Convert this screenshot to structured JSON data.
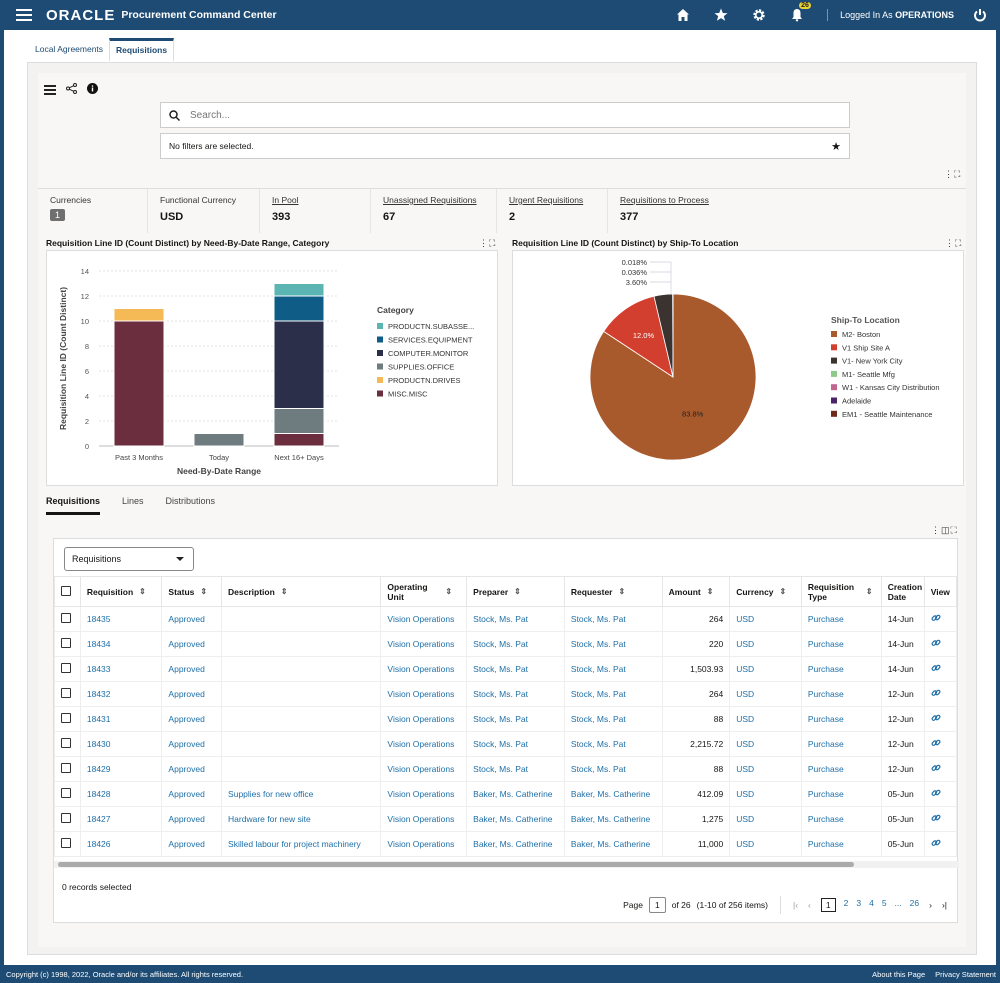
{
  "header": {
    "logo": "ORACLE",
    "app_title": "Procurement Command Center",
    "notification_count": "26",
    "logged_in_prefix": "Logged In As",
    "logged_in_user": "OPERATIONS",
    "icons": [
      "hamburger-icon",
      "home-icon",
      "star-icon",
      "gear-icon",
      "bell-icon",
      "power-icon"
    ]
  },
  "tabs": [
    {
      "label": "Local Agreements",
      "active": false
    },
    {
      "label": "Requisitions",
      "active": true
    }
  ],
  "search": {
    "placeholder": "Search...",
    "value": ""
  },
  "filters_text": "No filters are selected.",
  "kpis": [
    {
      "label": "Currencies",
      "value": "1",
      "badge": true,
      "link": false
    },
    {
      "label": "Functional Currency",
      "value": "USD",
      "link": false
    },
    {
      "label": "In Pool",
      "value": "393",
      "link": true
    },
    {
      "label": "Unassigned Requisitions",
      "value": "67",
      "link": true
    },
    {
      "label": "Urgent Requisitions",
      "value": "2",
      "link": true
    },
    {
      "label": "Requisitions to Process",
      "value": "377",
      "link": true
    }
  ],
  "chart_data": [
    {
      "type": "bar",
      "stacked": true,
      "title": "Requisition Line ID (Count Distinct) by Need-By-Date Range, Category",
      "xlabel": "Need-By-Date Range",
      "ylabel": "Requisition Line ID (Count Distinct)",
      "ylim": [
        0,
        14
      ],
      "yticks": [
        0,
        2,
        4,
        6,
        8,
        10,
        12,
        14
      ],
      "categories": [
        "Past 3 Months",
        "Today",
        "Next 16+ Days"
      ],
      "legend_title": "Category",
      "legend_position": "right",
      "series": [
        {
          "name": "MISC.MISC",
          "color": "#6b2e3e",
          "values": [
            10,
            0,
            1
          ]
        },
        {
          "name": "SUPPLIES.OFFICE",
          "color": "#6e7b7f",
          "values": [
            0,
            1,
            2
          ]
        },
        {
          "name": "COMPUTER.MONITOR",
          "color": "#2b2f4a",
          "values": [
            0,
            0,
            7
          ]
        },
        {
          "name": "SERVICES.EQUIPMENT",
          "color": "#0f5c86",
          "values": [
            0,
            0,
            2
          ]
        },
        {
          "name": "PRODUCTN.DRIVES",
          "color": "#f5b955",
          "values": [
            1,
            0,
            0
          ]
        },
        {
          "name": "PRODUCTN.SUBASSE...",
          "color": "#5bb5b3",
          "values": [
            0,
            0,
            1
          ]
        }
      ],
      "legend_order": [
        "PRODUCTN.SUBASSE...",
        "SERVICES.EQUIPMENT",
        "COMPUTER.MONITOR",
        "SUPPLIES.OFFICE",
        "PRODUCTN.DRIVES",
        "MISC.MISC"
      ]
    },
    {
      "type": "pie",
      "title": "Requisition Line ID (Count Distinct) by Ship-To Location",
      "legend_title": "Ship-To Location",
      "legend_position": "right",
      "slices": [
        {
          "name": "M2- Boston",
          "value": 83.8,
          "label": "83.8%",
          "color": "#a85a2d"
        },
        {
          "name": "V1 Ship Site A",
          "value": 12.0,
          "label": "12.0%",
          "color": "#d33f2e"
        },
        {
          "name": "V1- New York City",
          "value": 3.6,
          "label": "3.60%",
          "color": "#3a3330"
        },
        {
          "name": "M1- Seattle Mfg",
          "value": 0.036,
          "label": "0.036%",
          "color": "#8fc98a"
        },
        {
          "name": "W1 - Kansas City Distribution",
          "value": 0.018,
          "label": "0.018%",
          "color": "#c2668f"
        },
        {
          "name": "Adelaide",
          "value": 0,
          "label": "",
          "color": "#4a2466"
        },
        {
          "name": "EM1 - Seattle Maintenance",
          "value": 0,
          "label": "",
          "color": "#6e2b1a"
        }
      ]
    }
  ],
  "subtabs": [
    {
      "label": "Requisitions",
      "active": true
    },
    {
      "label": "Lines",
      "active": false
    },
    {
      "label": "Distributions",
      "active": false
    }
  ],
  "table": {
    "view_select": "Requisitions",
    "columns": [
      "Requisition",
      "Status",
      "Description",
      "Operating Unit",
      "Preparer",
      "Requester",
      "Amount",
      "Currency",
      "Requisition Type",
      "Creation Date",
      "View"
    ],
    "rows": [
      [
        "18435",
        "Approved",
        "",
        "Vision Operations",
        "Stock, Ms. Pat",
        "Stock, Ms. Pat",
        "264",
        "USD",
        "Purchase",
        "14-Jun"
      ],
      [
        "18434",
        "Approved",
        "",
        "Vision Operations",
        "Stock, Ms. Pat",
        "Stock, Ms. Pat",
        "220",
        "USD",
        "Purchase",
        "14-Jun"
      ],
      [
        "18433",
        "Approved",
        "",
        "Vision Operations",
        "Stock, Ms. Pat",
        "Stock, Ms. Pat",
        "1,503.93",
        "USD",
        "Purchase",
        "14-Jun"
      ],
      [
        "18432",
        "Approved",
        "",
        "Vision Operations",
        "Stock, Ms. Pat",
        "Stock, Ms. Pat",
        "264",
        "USD",
        "Purchase",
        "12-Jun"
      ],
      [
        "18431",
        "Approved",
        "",
        "Vision Operations",
        "Stock, Ms. Pat",
        "Stock, Ms. Pat",
        "88",
        "USD",
        "Purchase",
        "12-Jun"
      ],
      [
        "18430",
        "Approved",
        "",
        "Vision Operations",
        "Stock, Ms. Pat",
        "Stock, Ms. Pat",
        "2,215.72",
        "USD",
        "Purchase",
        "12-Jun"
      ],
      [
        "18429",
        "Approved",
        "",
        "Vision Operations",
        "Stock, Ms. Pat",
        "Stock, Ms. Pat",
        "88",
        "USD",
        "Purchase",
        "12-Jun"
      ],
      [
        "18428",
        "Approved",
        "Supplies for new office",
        "Vision Operations",
        "Baker, Ms. Catherine",
        "Baker, Ms. Catherine",
        "412.09",
        "USD",
        "Purchase",
        "05-Jun"
      ],
      [
        "18427",
        "Approved",
        "Hardware for new site",
        "Vision Operations",
        "Baker, Ms. Catherine",
        "Baker, Ms. Catherine",
        "1,275",
        "USD",
        "Purchase",
        "05-Jun"
      ],
      [
        "18426",
        "Approved",
        "Skilled labour for project machinery",
        "Vision Operations",
        "Baker, Ms. Catherine",
        "Baker, Ms. Catherine",
        "11,000",
        "USD",
        "Purchase",
        "05-Jun"
      ]
    ],
    "records_selected": "0 records selected"
  },
  "pagination": {
    "page_label": "Page",
    "current_page": "1",
    "of_label": "of 26",
    "range_text": "(1-10 of 256 items)",
    "pages": [
      "1",
      "2",
      "3",
      "4",
      "5",
      "...",
      "26"
    ]
  },
  "footer": {
    "copyright": "Copyright (c) 1998, 2022, Oracle and/or its affiliates. All rights reserved.",
    "about": "About this Page",
    "privacy": "Privacy Statement"
  }
}
